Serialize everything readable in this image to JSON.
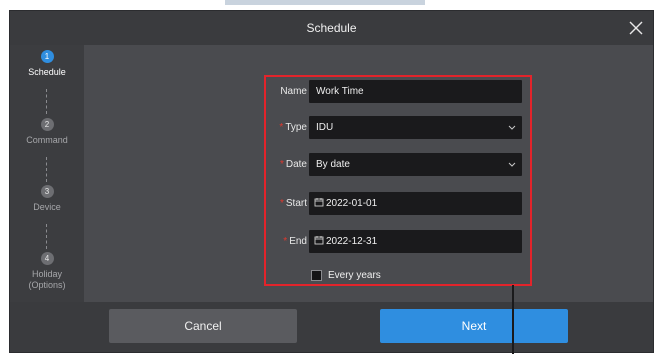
{
  "dialog": {
    "title": "Schedule",
    "close_icon": "close-icon"
  },
  "steps": [
    {
      "num": "1",
      "label": "Schedule",
      "active": true
    },
    {
      "num": "2",
      "label": "Command",
      "active": false
    },
    {
      "num": "3",
      "label": "Device",
      "active": false
    },
    {
      "num": "4",
      "label": "Holiday\n(Options)",
      "active": false
    }
  ],
  "form": {
    "name": {
      "label": "Name",
      "value": "Work Time",
      "required": false
    },
    "type": {
      "label": "Type",
      "value": "IDU",
      "required": true,
      "icon": "chevron-down-icon"
    },
    "date": {
      "label": "Date",
      "value": "By date",
      "required": true,
      "icon": "chevron-down-icon"
    },
    "start": {
      "label": "Start",
      "value": "2022-01-01",
      "required": true,
      "icon": "calendar-icon"
    },
    "end": {
      "label": "End",
      "value": "2022-12-31",
      "required": true,
      "icon": "calendar-icon"
    },
    "every_years": {
      "label": "Every years",
      "checked": false
    }
  },
  "footer": {
    "cancel_label": "Cancel",
    "next_label": "Next"
  },
  "colors": {
    "accent": "#2f8ee0",
    "required": "#e0382e",
    "highlight": "#e3242b"
  }
}
